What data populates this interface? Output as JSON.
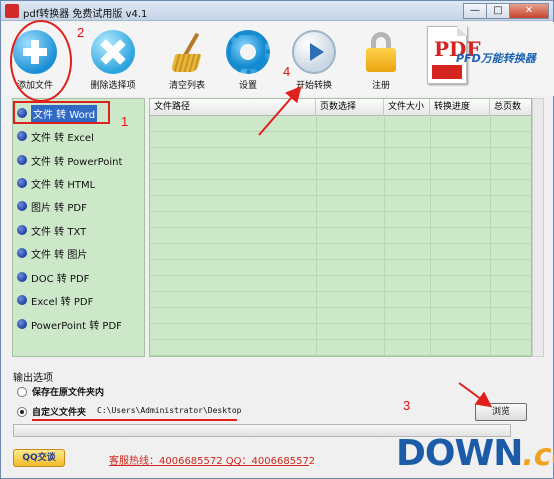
{
  "window": {
    "title": "pdf转换器 免费试用版 v4.1",
    "controls": {
      "minimize": "—",
      "maximize": "□",
      "close": "✕"
    }
  },
  "toolbar": {
    "items": [
      {
        "label": "添加文件",
        "icon": "add-file-icon"
      },
      {
        "label": "删除选择项",
        "icon": "delete-icon"
      },
      {
        "label": "清空列表",
        "icon": "broom-icon"
      },
      {
        "label": "设置",
        "icon": "gear-icon"
      },
      {
        "label": "开始转换",
        "icon": "play-icon"
      },
      {
        "label": "注册",
        "icon": "lock-icon"
      }
    ],
    "brand": {
      "logo_text": "PDF",
      "brand_text": "PFD万能转换器"
    }
  },
  "conversions": [
    "文件 转 Word",
    "文件 转 Excel",
    "文件 转 PowerPoint",
    "文件 转 HTML",
    "图片 转 PDF",
    "文件 转 TXT",
    "文件 转 图片",
    "DOC 转 PDF",
    "Excel 转 PDF",
    "PowerPoint 转 PDF"
  ],
  "selected_conversion": "文件 转 Word",
  "table": {
    "headers": [
      "文件路径",
      "页数选择",
      "文件大小",
      "转换进度",
      "总页数"
    ]
  },
  "output": {
    "section_title": "输出选项",
    "option_original": "保存在原文件夹内",
    "option_custom": "自定义文件夹",
    "selected": "custom",
    "path": "C:\\Users\\Administrator\\Desktop",
    "browse_label": "浏览",
    "progress": 0
  },
  "footer": {
    "qq_label": "QQ交谈",
    "hotline": "客服热线：4006685572 QQ：4006685572"
  },
  "annotations": [
    "1",
    "2",
    "3",
    "4"
  ],
  "watermark": {
    "main": "DOWN",
    "suffix": ".cc"
  },
  "colors": {
    "panel_green": "#cde8c9",
    "selection_blue": "#316ac5",
    "annotation_red": "#e0201c",
    "hotline_red": "#d0261d"
  }
}
